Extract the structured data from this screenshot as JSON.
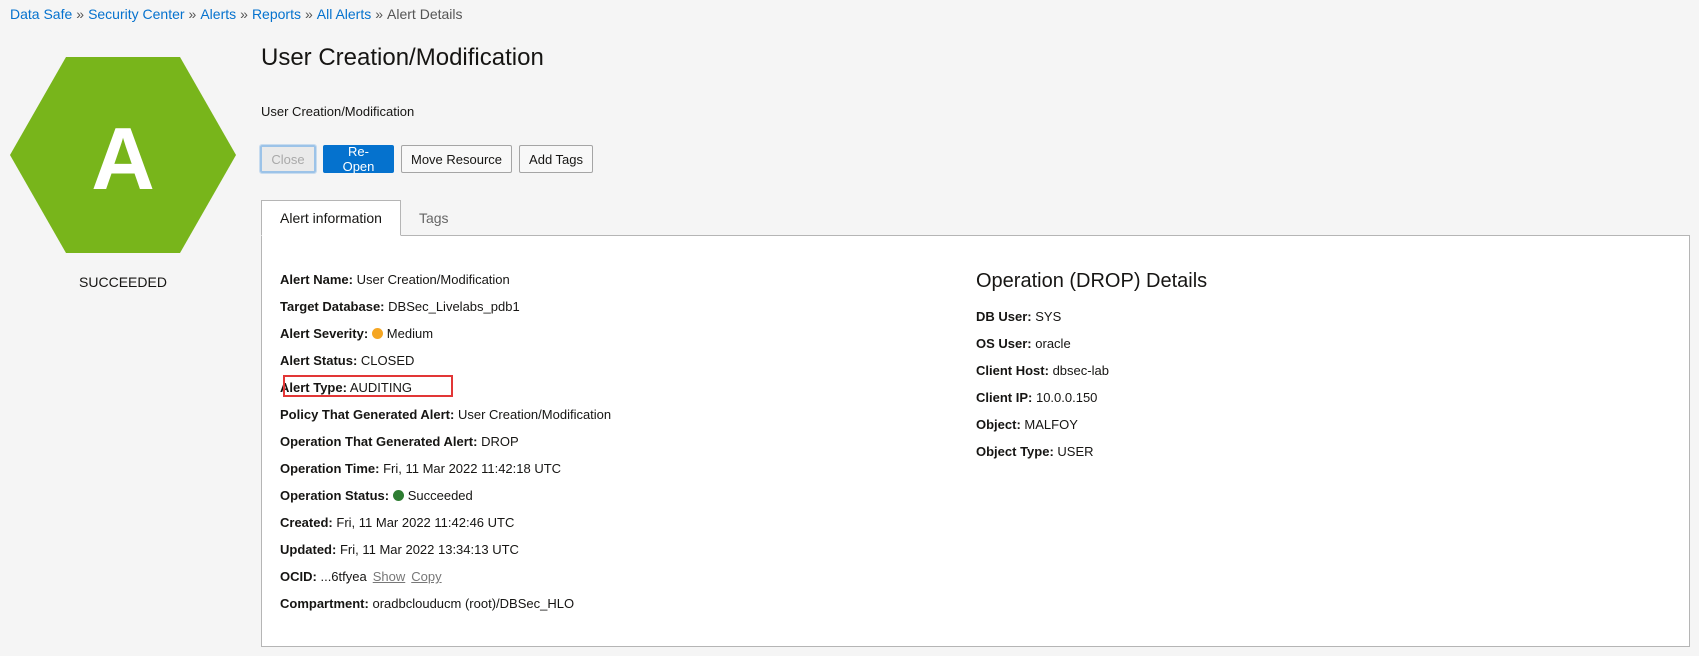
{
  "breadcrumb": {
    "items": [
      "Data Safe",
      "Security Center",
      "Alerts",
      "Reports",
      "All Alerts"
    ],
    "current": "Alert Details",
    "separator": "»"
  },
  "badge": {
    "letter": "A",
    "status": "SUCCEEDED",
    "color": "#78b51b"
  },
  "header": {
    "title": "User Creation/Modification",
    "subtitle": "User Creation/Modification"
  },
  "actions": {
    "close": "Close",
    "reopen": "Re-Open",
    "move": "Move Resource",
    "add_tags": "Add Tags"
  },
  "tabs": {
    "info": "Alert information",
    "tags": "Tags"
  },
  "alert_info": {
    "name_label": "Alert Name:",
    "name": "User Creation/Modification",
    "target_label": "Target Database:",
    "target": "DBSec_Livelabs_pdb1",
    "severity_label": "Alert Severity:",
    "severity": "Medium",
    "status_label": "Alert Status:",
    "status": "CLOSED",
    "type_label": "Alert Type:",
    "type": "AUDITING",
    "policy_label": "Policy That Generated Alert:",
    "policy": "User Creation/Modification",
    "operation_label": "Operation That Generated Alert:",
    "operation": "DROP",
    "op_time_label": "Operation Time:",
    "op_time": "Fri, 11 Mar 2022 11:42:18 UTC",
    "op_status_label": "Operation Status:",
    "op_status": "Succeeded",
    "created_label": "Created:",
    "created": "Fri, 11 Mar 2022 11:42:46 UTC",
    "updated_label": "Updated:",
    "updated": "Fri, 11 Mar 2022 13:34:13 UTC",
    "ocid_label": "OCID:",
    "ocid": "...6tfyea",
    "ocid_show": "Show",
    "ocid_copy": "Copy",
    "compartment_label": "Compartment:",
    "compartment": "oradbclouducm (root)/DBSec_HLO"
  },
  "operation_details": {
    "title": "Operation (DROP) Details",
    "db_user_label": "DB User:",
    "db_user": "SYS",
    "os_user_label": "OS User:",
    "os_user": "oracle",
    "client_host_label": "Client Host:",
    "client_host": "dbsec-lab",
    "client_ip_label": "Client IP:",
    "client_ip": "10.0.0.150",
    "object_label": "Object:",
    "object": "MALFOY",
    "object_type_label": "Object Type:",
    "object_type": "USER"
  }
}
